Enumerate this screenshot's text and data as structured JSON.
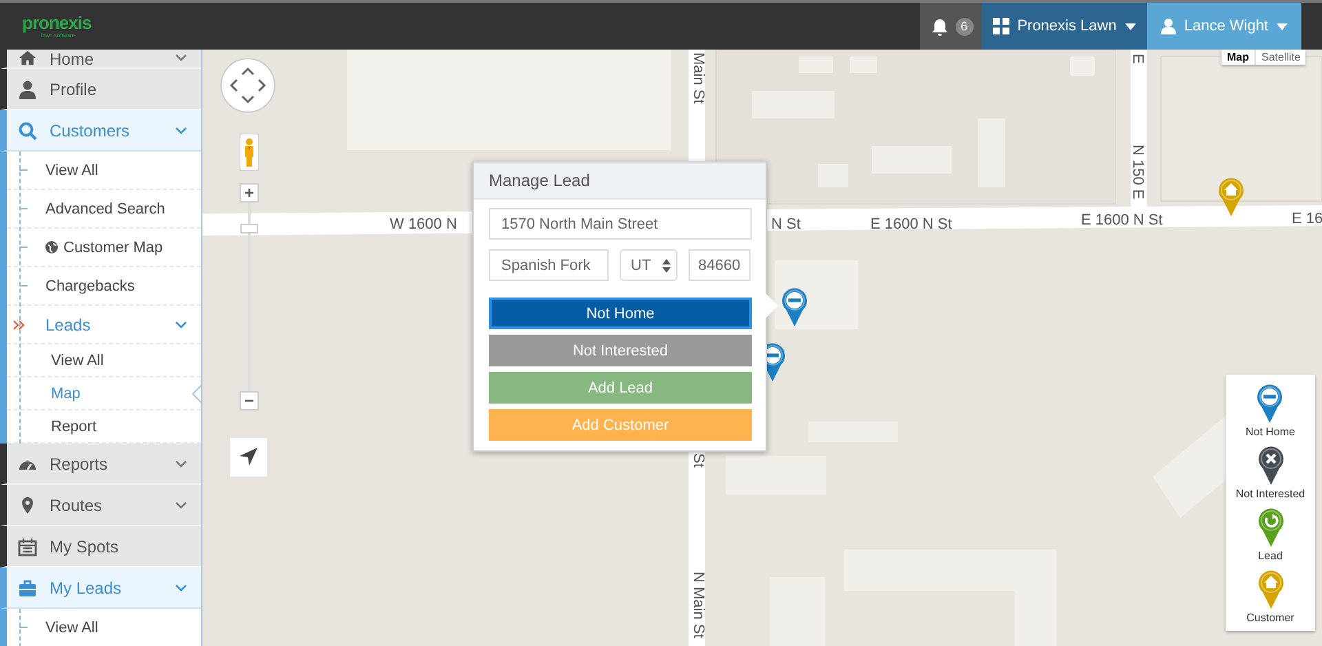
{
  "header": {
    "logo_text": "pronexis",
    "logo_tagline": "lawn software",
    "notification_count": "6",
    "company": "Pronexis Lawn",
    "user": "Lance Wight"
  },
  "sidebar": {
    "items": [
      {
        "label": "Home",
        "expanded": false
      },
      {
        "label": "Profile"
      },
      {
        "label": "Customers",
        "expanded": true,
        "children": [
          {
            "label": "View All",
            "selected": false
          },
          {
            "label": "Advanced Search",
            "selected": false
          },
          {
            "label": "Customer Map",
            "selected": false
          },
          {
            "label": "Chargebacks",
            "selected": false
          },
          {
            "label": "Leads",
            "expanded": true,
            "selected": false,
            "children": [
              {
                "label": "View All",
                "selected": false
              },
              {
                "label": "Map",
                "selected": true
              },
              {
                "label": "Report",
                "selected": false
              }
            ]
          }
        ]
      },
      {
        "label": "Reports",
        "expanded": false
      },
      {
        "label": "Routes",
        "expanded": false
      },
      {
        "label": "My Spots"
      },
      {
        "label": "My Leads",
        "expanded": true,
        "children": [
          {
            "label": "View All",
            "selected": false
          }
        ]
      }
    ]
  },
  "map": {
    "map_types": [
      {
        "label": "Map",
        "selected": true
      },
      {
        "label": "Satellite",
        "selected": false
      }
    ],
    "road_labels": [
      {
        "text": "Main St"
      },
      {
        "text": "E"
      },
      {
        "text": "N 150 E"
      },
      {
        "text": "W 1600 N"
      },
      {
        "text": "N St"
      },
      {
        "text": "E 1600 N St"
      },
      {
        "text": "E 1600 N St"
      },
      {
        "text": "E 16"
      },
      {
        "text": "St"
      },
      {
        "text": "N Main St"
      }
    ],
    "markers": [
      {
        "kind": "not_home"
      },
      {
        "kind": "not_home"
      },
      {
        "kind": "customer"
      }
    ],
    "legend": [
      {
        "kind": "not_home",
        "label": "Not Home"
      },
      {
        "kind": "not_interested",
        "label": "Not Interested"
      },
      {
        "kind": "lead",
        "label": "Lead"
      },
      {
        "kind": "customer",
        "label": "Customer"
      }
    ]
  },
  "dialog": {
    "title": "Manage Lead",
    "address": "1570 North Main Street",
    "city": "Spanish Fork",
    "state": "UT",
    "zip": "84660",
    "buttons": [
      {
        "kind": "not_home",
        "label": "Not Home",
        "focused": true
      },
      {
        "kind": "not_interested",
        "label": "Not Interested",
        "focused": false
      },
      {
        "kind": "add_lead",
        "label": "Add Lead",
        "focused": false
      },
      {
        "kind": "add_customer",
        "label": "Add Customer",
        "focused": false
      }
    ]
  }
}
